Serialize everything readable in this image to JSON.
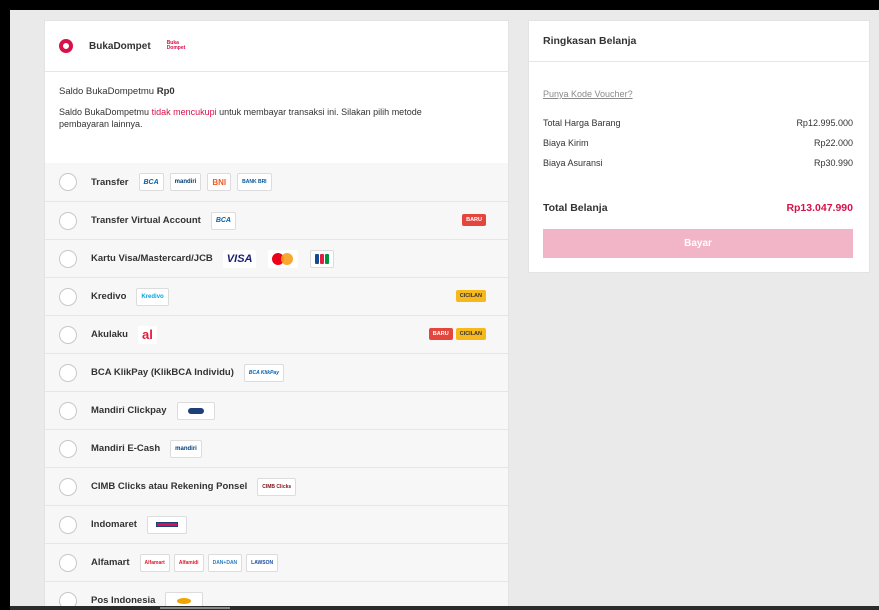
{
  "bukadompet": {
    "title": "BukaDompet",
    "logo_text": "Buka Dompet",
    "saldo_prefix": "Saldo BukaDompetmu ",
    "saldo_value": "Rp0",
    "note_prefix": "Saldo BukaDompetmu ",
    "note_red": "tidak mencukupi",
    "note_suffix": " untuk membayar transaksi ini. Silakan pilih metode pembayaran lainnya."
  },
  "methods": [
    {
      "label": "Transfer",
      "logos": [
        "BCA",
        "mandiri",
        "BNI",
        "BANK BRI"
      ]
    },
    {
      "label": "Transfer Virtual Account",
      "logos": [
        "BCA"
      ],
      "badges": [
        "BARU"
      ]
    },
    {
      "label": "Kartu Visa/Mastercard/JCB",
      "logos": [
        "VISA",
        "mastercard",
        "JCB"
      ]
    },
    {
      "label": "Kredivo",
      "logos": [
        "Kredivo"
      ],
      "badges": [
        "CICILAN"
      ]
    },
    {
      "label": "Akulaku",
      "logos": [
        "al"
      ],
      "badges": [
        "BARU",
        "CICILAN"
      ]
    },
    {
      "label": "BCA KlikPay (KlikBCA Individu)",
      "logos": [
        "BCA KlikPay"
      ]
    },
    {
      "label": "Mandiri Clickpay",
      "logos": [
        "token"
      ]
    },
    {
      "label": "Mandiri E-Cash",
      "logos": [
        "mandiri"
      ]
    },
    {
      "label": "CIMB Clicks atau Rekening Ponsel",
      "logos": [
        "CIMB Clicks"
      ]
    },
    {
      "label": "Indomaret",
      "logos": [
        "Indomaret"
      ]
    },
    {
      "label": "Alfamart",
      "logos": [
        "Alfamart",
        "Alfamidi",
        "DAN+DAN",
        "LAWSON"
      ]
    },
    {
      "label": "Pos Indonesia",
      "logos": [
        "pos"
      ]
    }
  ],
  "summary": {
    "title": "Ringkasan Belanja",
    "voucher_link": "Punya Kode Voucher?",
    "rows": [
      {
        "label": "Total Harga Barang",
        "value": "Rp12.995.000"
      },
      {
        "label": "Biaya Kirim",
        "value": "Rp22.000"
      },
      {
        "label": "Biaya Asuransi",
        "value": "Rp30.990"
      }
    ],
    "total_label": "Total Belanja",
    "total_value": "Rp13.047.990",
    "pay_button": "Bayar"
  },
  "colors": {
    "brand": "#d71149",
    "pay_button": "#f2b5c8",
    "badge_new": "#e4463e",
    "badge_installment": "#f6b81c"
  }
}
